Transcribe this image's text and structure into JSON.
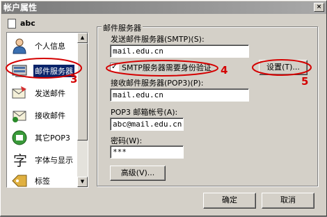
{
  "window": {
    "title": "帐户属性",
    "close_glyph": "×"
  },
  "account": {
    "name": "abc"
  },
  "nav": {
    "items": [
      {
        "id": "personal",
        "label": "个人信息",
        "selected": false
      },
      {
        "id": "mail-server",
        "label": "邮件服务器",
        "selected": true
      },
      {
        "id": "send",
        "label": "发送邮件",
        "selected": false
      },
      {
        "id": "receive",
        "label": "接收邮件",
        "selected": false
      },
      {
        "id": "other-pop3",
        "label": "其它POP3",
        "selected": false
      },
      {
        "id": "font",
        "label": "字体与显示",
        "selected": false
      },
      {
        "id": "tags",
        "label": "标签",
        "selected": false
      }
    ]
  },
  "server": {
    "group_title": "邮件服务器",
    "smtp_label": "发送邮件服务器(SMTP)(S):",
    "smtp_value": "mail.edu.cn",
    "auth_checkbox_label": "SMTP服务器需要身份验证",
    "auth_checked": true,
    "settings_button": "设置(T)...",
    "pop3_label": "接收邮件服务器(POP3)(P):",
    "pop3_value": "mail.edu.cn",
    "account_label": "POP3 邮箱帐号(A):",
    "account_value": "abc@mail.edu.cn",
    "password_label": "密码(W):",
    "password_value": "***",
    "advanced_button": "高级(V)..."
  },
  "footer": {
    "ok": "确定",
    "cancel": "取消"
  },
  "annotations": {
    "n3": "3",
    "n4": "4",
    "n5": "5",
    "color": "#d40000"
  }
}
